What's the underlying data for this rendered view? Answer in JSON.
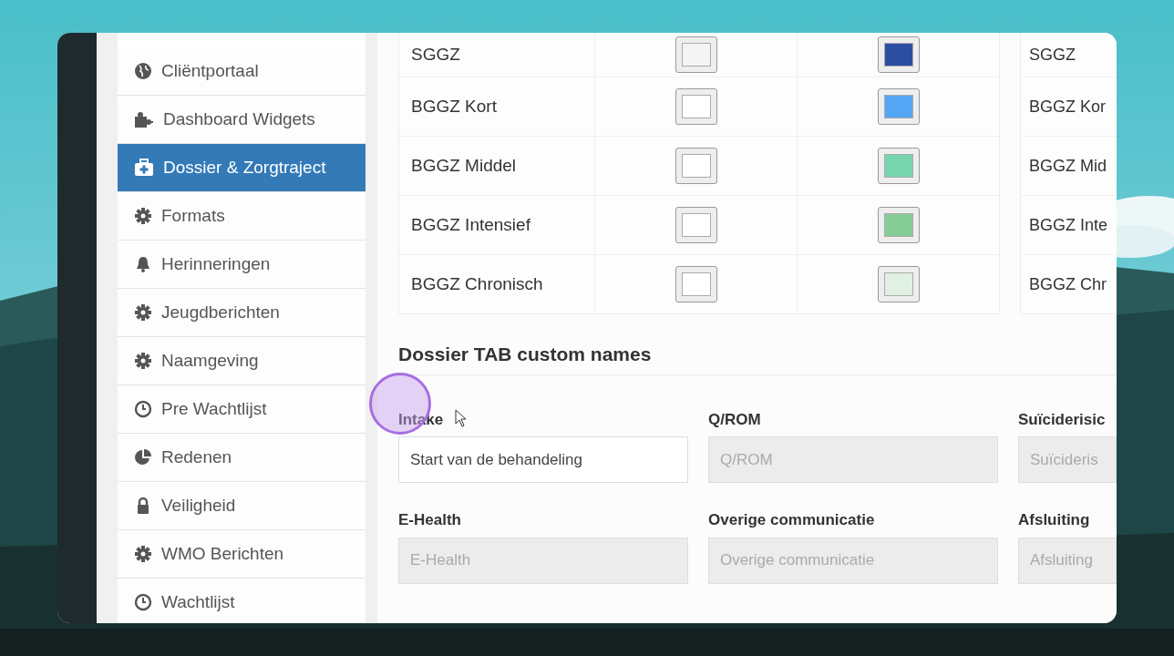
{
  "sidebar": {
    "items": [
      {
        "label": "Cliëntportaal",
        "selected": false
      },
      {
        "label": "Dashboard Widgets",
        "selected": false
      },
      {
        "label": "Dossier & Zorgtraject",
        "selected": true
      },
      {
        "label": "Formats",
        "selected": false
      },
      {
        "label": "Herinneringen",
        "selected": false
      },
      {
        "label": "Jeugdberichten",
        "selected": false
      },
      {
        "label": "Naamgeving",
        "selected": false
      },
      {
        "label": "Pre Wachtlijst",
        "selected": false
      },
      {
        "label": "Redenen",
        "selected": false
      },
      {
        "label": "Veiligheid",
        "selected": false
      },
      {
        "label": "WMO Berichten",
        "selected": false
      },
      {
        "label": "Wachtlijst",
        "selected": false
      }
    ]
  },
  "color_table": {
    "rows": [
      {
        "name": "SGGZ",
        "swatches": [
          {
            "color": "#f4f4f4"
          },
          {
            "color": "#2b4ea3"
          }
        ]
      },
      {
        "name": "BGGZ Kort",
        "swatches": [
          {
            "color": "#ffffff"
          },
          {
            "color": "#55a6f5"
          }
        ]
      },
      {
        "name": "BGGZ Middel",
        "swatches": [
          {
            "color": "#ffffff"
          },
          {
            "color": "#76d4ae"
          }
        ]
      },
      {
        "name": "BGGZ Intensief",
        "swatches": [
          {
            "color": "#ffffff"
          },
          {
            "color": "#86cc97"
          }
        ]
      },
      {
        "name": "BGGZ Chronisch",
        "swatches": [
          {
            "color": "#ffffff"
          },
          {
            "color": "#e0f0e3"
          }
        ]
      }
    ]
  },
  "side_table": {
    "rows": [
      "SGGZ",
      "BGGZ Kor",
      "BGGZ Mid",
      "BGGZ Inte",
      "BGGZ Chr"
    ]
  },
  "section": {
    "title": "Dossier TAB custom names",
    "fields": [
      {
        "label": "Intake",
        "value": "Start van de behandeling",
        "disabled": false
      },
      {
        "label": "Q/ROM",
        "placeholder": "Q/ROM",
        "disabled": true
      },
      {
        "label": "Suïciderisic",
        "placeholder": "Suïcideris",
        "disabled": true
      },
      {
        "label": "E-Health",
        "placeholder": "E-Health",
        "disabled": true
      },
      {
        "label": "Overige communicatie",
        "placeholder": "Overige communicatie",
        "disabled": true
      },
      {
        "label": "Afsluiting",
        "placeholder": "Afsluiting",
        "disabled": true
      }
    ]
  }
}
